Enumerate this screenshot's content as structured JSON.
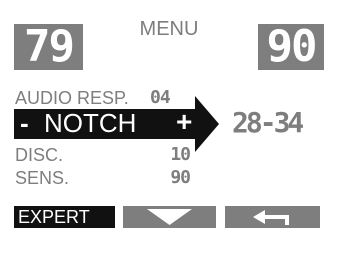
{
  "menu": {
    "title": "MENU",
    "left_value": "79",
    "right_value": "90"
  },
  "rows": {
    "audio_resp": {
      "label": "AUDIO RESP.",
      "value": "04"
    },
    "notch": {
      "minus": "-",
      "label": "NOTCH",
      "plus": "+",
      "range": "28-34"
    },
    "disc": {
      "label": "DISC.",
      "value": "10"
    },
    "sens": {
      "label": "SENS.",
      "value": "90"
    }
  },
  "softkeys": {
    "expert": "EXPERT",
    "down_icon": "chevron-down-icon",
    "back_icon": "back-arrow-icon"
  },
  "colors": {
    "accent_gray": "#7e7e7e",
    "selected_black": "#111111",
    "background": "#ffffff"
  }
}
